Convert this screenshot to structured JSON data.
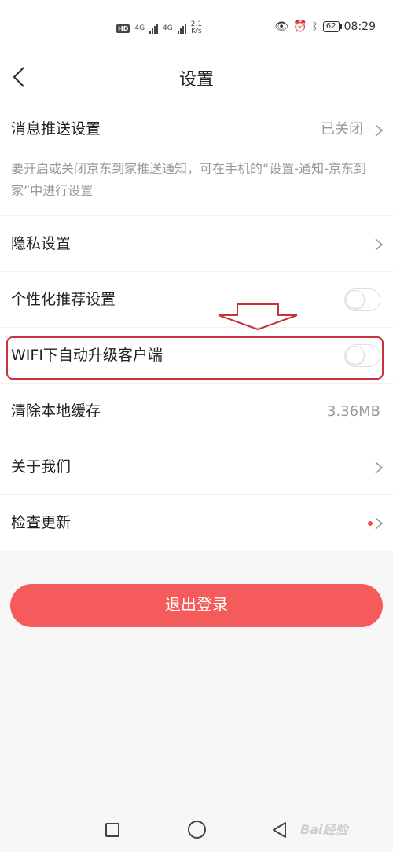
{
  "status_bar": {
    "hd": "HD",
    "net1": "4G",
    "net2": "4G",
    "speed_value": "2.1",
    "speed_unit": "K/s",
    "battery": "62",
    "time": "08:29"
  },
  "nav": {
    "title": "设置"
  },
  "settings": {
    "push": {
      "label": "消息推送设置",
      "value": "已关闭",
      "description": "要开启或关闭京东到家推送通知，可在手机的“设置-通知-京东到家”中进行设置"
    },
    "privacy": {
      "label": "隐私设置"
    },
    "personalized": {
      "label": "个性化推荐设置",
      "enabled": false
    },
    "wifi_update": {
      "label": "WIFI下自动升级客户端",
      "enabled": false
    },
    "clear_cache": {
      "label": "清除本地缓存",
      "value": "3.36MB"
    },
    "about": {
      "label": "关于我们"
    },
    "check_update": {
      "label": "检查更新"
    }
  },
  "logout": {
    "label": "退出登录"
  },
  "watermark": "Bai经验",
  "colors": {
    "accent": "#f55b5b",
    "annotation": "#c8323c"
  }
}
